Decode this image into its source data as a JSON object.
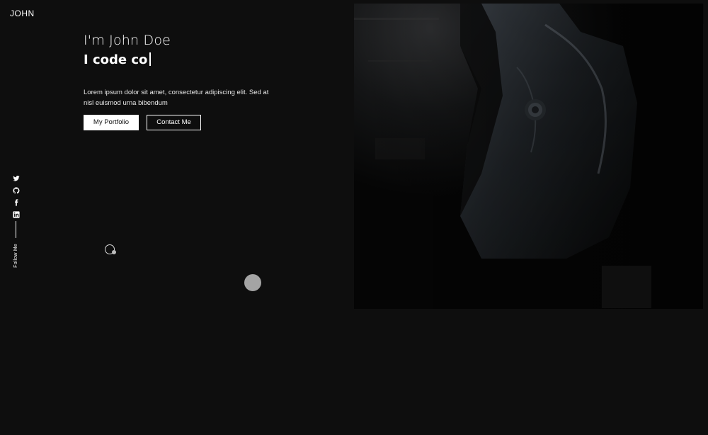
{
  "header": {
    "logo": "JOHN",
    "theme_toggle_icon": "half-circle-icon",
    "menu_icon": "hamburger-icon"
  },
  "hero": {
    "greeting": "I'm John Doe",
    "typed_text": "I code co",
    "bio": "Lorem ipsum dolor sit amet, consectetur adipiscing elit. Sed at nisl euismod urna bibendum",
    "buttons": {
      "portfolio": "My Portfolio",
      "contact": "Contact Me"
    },
    "image_icon": "hooded-figure-photo"
  },
  "social": {
    "follow_label": "Follow Me",
    "items": [
      {
        "name": "twitter",
        "icon": "twitter-icon"
      },
      {
        "name": "github",
        "icon": "github-icon"
      },
      {
        "name": "facebook",
        "icon": "facebook-icon"
      },
      {
        "name": "linkedin",
        "icon": "linkedin-icon"
      }
    ]
  },
  "colors": {
    "background": "#0e0e0e",
    "text": "#ffffff",
    "accent_button_bg": "#ffffff",
    "accent_button_text": "#111111",
    "blob": "#a4a4a4"
  }
}
